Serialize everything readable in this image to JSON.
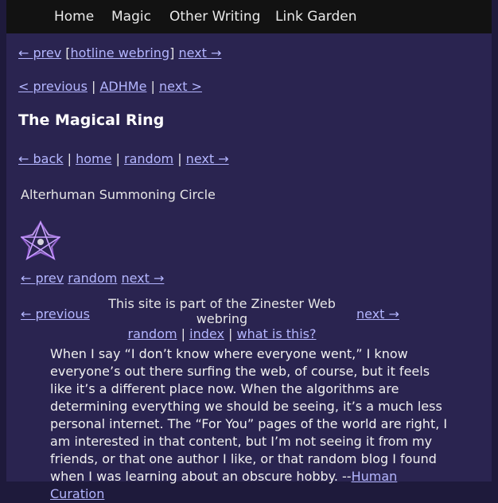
{
  "nav": {
    "items": [
      "Home",
      "Magic",
      "Other Writing",
      "Link Garden"
    ]
  },
  "hotline_ring": {
    "prev": "← prev",
    "open_bracket": "[",
    "name": "hotline webring",
    "close_bracket": "]",
    "next": "next →"
  },
  "adhd_ring": {
    "previous": "< previous",
    "sep": "|",
    "name": "ADHMe",
    "next": "next >"
  },
  "magical_ring": {
    "title": "The Magical Ring",
    "back": "← back",
    "home": "home",
    "random": "random",
    "next": "next →",
    "sep": "|"
  },
  "alterhuman": {
    "title": "Alterhuman Summoning Circle",
    "prev": "← prev",
    "random": "random",
    "next": "next →",
    "icon": "heptagram-star-icon"
  },
  "zinester": {
    "previous": "← previous",
    "text": "This site is part of the Zinester Web webring",
    "random": "random",
    "index": "index",
    "what": "what is this?",
    "next": "next →",
    "sep": "|"
  },
  "quote": {
    "body": "When I say “I don’t know where everyone went,” I know everyone’s out there surfing the web, of course, but it feels like it’s a different place now. When the algorithms are determining everything we should be seeing, it’s a much less personal internet. The “For You” pages of the world are right, I am interested in that content, but I’m not seeing it from my friends, or that one author I like, or that random blog I found when I was learning about an obscure hobby. --",
    "source": "Human Curation"
  },
  "colors": {
    "background": "#2a2450",
    "outer": "#1e1a3b",
    "nav": "#121212",
    "link": "#b4b6ff"
  }
}
